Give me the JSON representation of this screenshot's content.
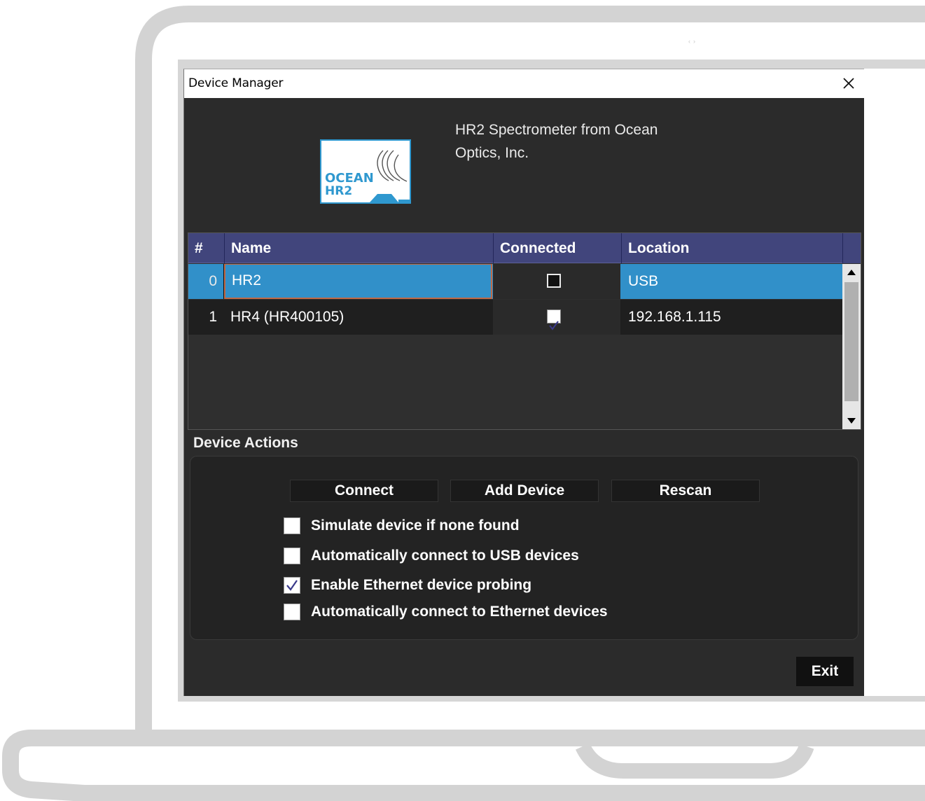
{
  "window": {
    "title": "Device Manager"
  },
  "device_info": {
    "logo_line1": "OCEAN",
    "logo_line2": "HR2",
    "description": "HR2 Spectrometer from Ocean Optics, Inc."
  },
  "table": {
    "columns": [
      "#",
      "Name",
      "Connected",
      "Location"
    ],
    "rows": [
      {
        "index": "0",
        "name": "HR2",
        "connected": false,
        "location": "USB",
        "selected": true
      },
      {
        "index": "1",
        "name": "HR4 (HR400105)",
        "connected": true,
        "location": "192.168.1.115",
        "selected": false
      }
    ]
  },
  "actions": {
    "title": "Device Actions",
    "buttons": {
      "connect": "Connect",
      "add_device": "Add Device",
      "rescan": "Rescan"
    },
    "options": [
      {
        "label": "Simulate device if none found",
        "checked": false
      },
      {
        "label": "Automatically connect to USB devices",
        "checked": false
      },
      {
        "label": "Enable Ethernet device probing",
        "checked": true
      },
      {
        "label": "Automatically connect to Ethernet devices",
        "checked": false
      }
    ]
  },
  "footer": {
    "exit_label": "Exit"
  },
  "colors": {
    "header_bg": "#41457c",
    "selected_row": "#3190c9",
    "dialog_bg": "#2b2b2b",
    "logo_accent": "#2f98cf"
  }
}
